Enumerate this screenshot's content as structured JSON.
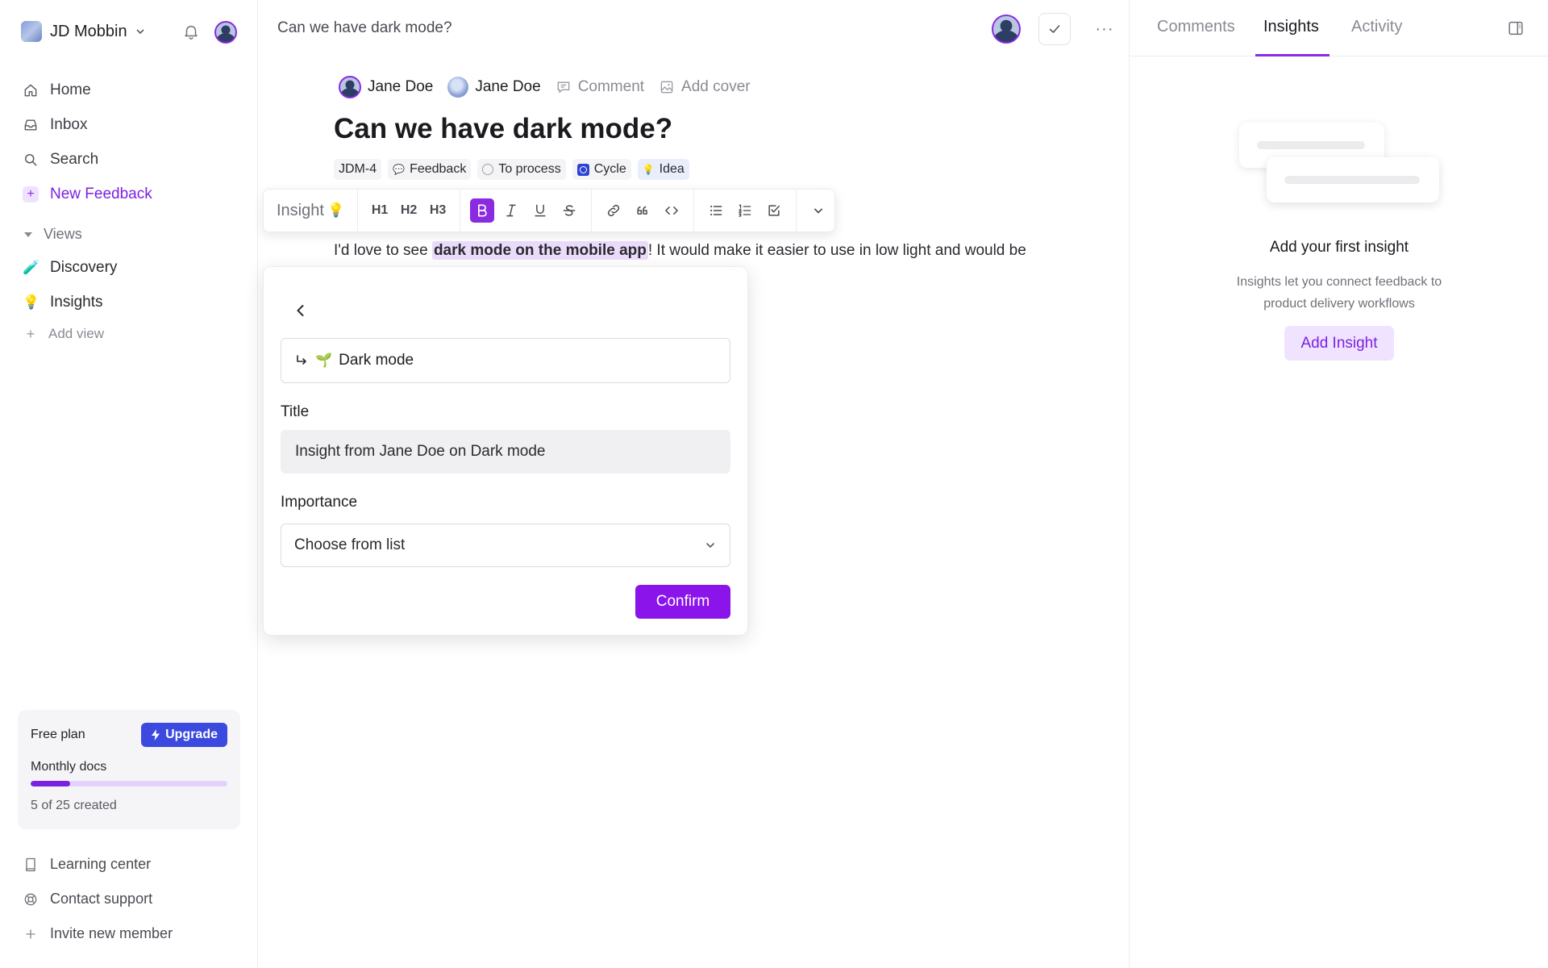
{
  "sidebar": {
    "workspace": "JD Mobbin",
    "nav": [
      {
        "label": "Home",
        "icon": "home-icon"
      },
      {
        "label": "Inbox",
        "icon": "inbox-icon"
      },
      {
        "label": "Search",
        "icon": "search-icon"
      },
      {
        "label": "New Feedback",
        "icon": "plus-icon"
      }
    ],
    "views_heading": "Views",
    "views": [
      {
        "label": "Discovery",
        "emoji": "🧪"
      },
      {
        "label": "Insights",
        "emoji": "💡"
      }
    ],
    "add_view": "Add view",
    "plan": {
      "name": "Free plan",
      "upgrade_label": "Upgrade",
      "usage_label": "Monthly docs",
      "usage_text": "5 of 25 created",
      "used": 5,
      "limit": 25
    },
    "bottom_links": [
      {
        "label": "Learning center",
        "icon": "book-icon"
      },
      {
        "label": "Contact support",
        "icon": "lifebuoy-icon"
      },
      {
        "label": "Invite new member",
        "icon": "plus-icon"
      }
    ]
  },
  "doc": {
    "breadcrumb_title": "Can we have dark mode?",
    "authors": [
      "Jane Doe",
      "Jane Doe"
    ],
    "comment_label": "Comment",
    "add_cover_label": "Add cover",
    "title": "Can we have dark mode?",
    "tags": [
      {
        "label": "JDM-4",
        "icon": ""
      },
      {
        "label": "Feedback",
        "icon": "💬"
      },
      {
        "label": "To process",
        "icon": "status-circle-icon"
      },
      {
        "label": "Cycle",
        "icon": "cycle-icon"
      },
      {
        "label": "Idea",
        "icon": "💡"
      }
    ],
    "body_before": "I'd love to see ",
    "body_highlight": "dark mode on the mobile app",
    "body_after": "! It would make it easier to use in low light and would be"
  },
  "toolbar": {
    "insight_label": "Insight",
    "insight_emoji": "💡",
    "headings": [
      "H1",
      "H2",
      "H3"
    ]
  },
  "popover": {
    "parent_emoji": "🌱",
    "parent_value": "Dark mode",
    "title_label": "Title",
    "title_value": "Insight from Jane Doe on Dark mode",
    "importance_label": "Importance",
    "importance_placeholder": "Choose from list",
    "confirm_label": "Confirm"
  },
  "right_panel": {
    "tabs": [
      "Comments",
      "Insights",
      "Activity"
    ],
    "active_tab": "Insights",
    "empty_title": "Add your first insight",
    "empty_desc": "Insights let you connect feedback to product delivery workflows",
    "add_button": "Add Insight"
  },
  "colors": {
    "accent": "#8a2be2",
    "upgrade": "#3b49df",
    "highlight": "#ecdcfb"
  }
}
